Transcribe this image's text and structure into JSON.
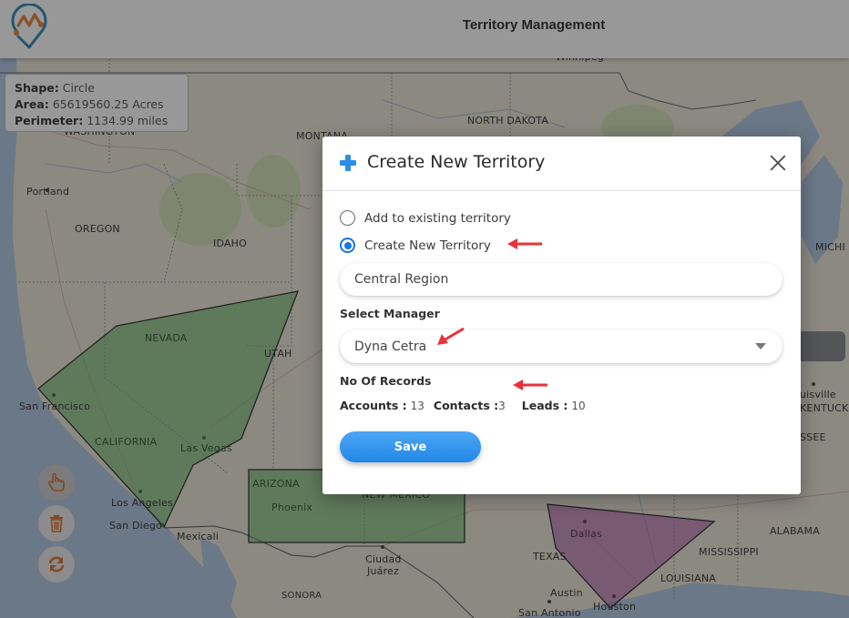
{
  "header": {
    "title": "Territory Management",
    "logo_icon": "map-pin-logo-icon"
  },
  "shape_info": {
    "shape_label": "Shape:",
    "shape_value": "Circle",
    "area_label": "Area:",
    "area_value": "65619560.25 Acres",
    "perimeter_label": "Perimeter:",
    "perimeter_value": "1134.99 miles"
  },
  "tools": [
    {
      "name": "draw",
      "icon": "hand-pointer-icon",
      "active": true
    },
    {
      "name": "delete",
      "icon": "trash-icon",
      "active": false
    },
    {
      "name": "refresh",
      "icon": "refresh-icon",
      "active": false
    }
  ],
  "map": {
    "labels": [
      {
        "text": "Winnipeg",
        "kind": "city"
      },
      {
        "text": "NORTH DAKOTA",
        "kind": "state"
      },
      {
        "text": "MONTANA",
        "kind": "state"
      },
      {
        "text": "WASHINGTON",
        "kind": "state"
      },
      {
        "text": "Portland",
        "kind": "city"
      },
      {
        "text": "OREGON",
        "kind": "state"
      },
      {
        "text": "IDAHO",
        "kind": "state"
      },
      {
        "text": "NEVADA",
        "kind": "state"
      },
      {
        "text": "UTAH",
        "kind": "state"
      },
      {
        "text": "San Francisco",
        "kind": "city"
      },
      {
        "text": "CALIFORNIA",
        "kind": "state"
      },
      {
        "text": "Las Vegas",
        "kind": "city"
      },
      {
        "text": "Los Angeles",
        "kind": "city"
      },
      {
        "text": "San Diego",
        "kind": "city"
      },
      {
        "text": "Mexicali",
        "kind": "city"
      },
      {
        "text": "ARIZONA",
        "kind": "state"
      },
      {
        "text": "Phoenix",
        "kind": "city"
      },
      {
        "text": "NEW MEXICO",
        "kind": "state"
      },
      {
        "text": "Ciudad",
        "kind": "city"
      },
      {
        "text": "Juárez",
        "kind": "city"
      },
      {
        "text": "SONORA",
        "kind": "state"
      },
      {
        "text": "Dallas",
        "kind": "city"
      },
      {
        "text": "TEXAS",
        "kind": "state"
      },
      {
        "text": "Austin",
        "kind": "city"
      },
      {
        "text": "San Antonio",
        "kind": "city"
      },
      {
        "text": "Houston",
        "kind": "city"
      },
      {
        "text": "LOUISIANA",
        "kind": "state"
      },
      {
        "text": "MISSISSIPPI",
        "kind": "state"
      },
      {
        "text": "ALABAMA",
        "kind": "state"
      },
      {
        "text": "MICHI",
        "kind": "state"
      },
      {
        "text": "uisville",
        "kind": "city"
      },
      {
        "text": "KENTUCK",
        "kind": "state"
      },
      {
        "text": "SSEE",
        "kind": "state"
      }
    ],
    "territories": [
      {
        "name": "west-polygon",
        "color": "#4caf50"
      },
      {
        "name": "southwest-rectangle",
        "color": "#4caf50"
      },
      {
        "name": "texas-polygon",
        "color": "#a64ca6"
      }
    ]
  },
  "modal": {
    "title": "Create New Territory",
    "radio_options": [
      {
        "label": "Add to existing territory",
        "checked": false
      },
      {
        "label": "Create New Territory",
        "checked": true
      }
    ],
    "territory_name_value": "Central Region",
    "manager_label": "Select Manager",
    "manager_value": "Dyna Cetra",
    "records_label": "No Of Records",
    "records": {
      "accounts_label": "Accounts :",
      "accounts_value": "13",
      "contacts_label": "Contacts :",
      "contacts_value": "3",
      "leads_label": "Leads :",
      "leads_value": "10"
    },
    "save_label": "Save"
  },
  "colors": {
    "accent": "#2188e6",
    "radio_checked": "#1a73e8",
    "annotation_arrow": "#e8313a",
    "tool_icon": "#d2691e"
  }
}
